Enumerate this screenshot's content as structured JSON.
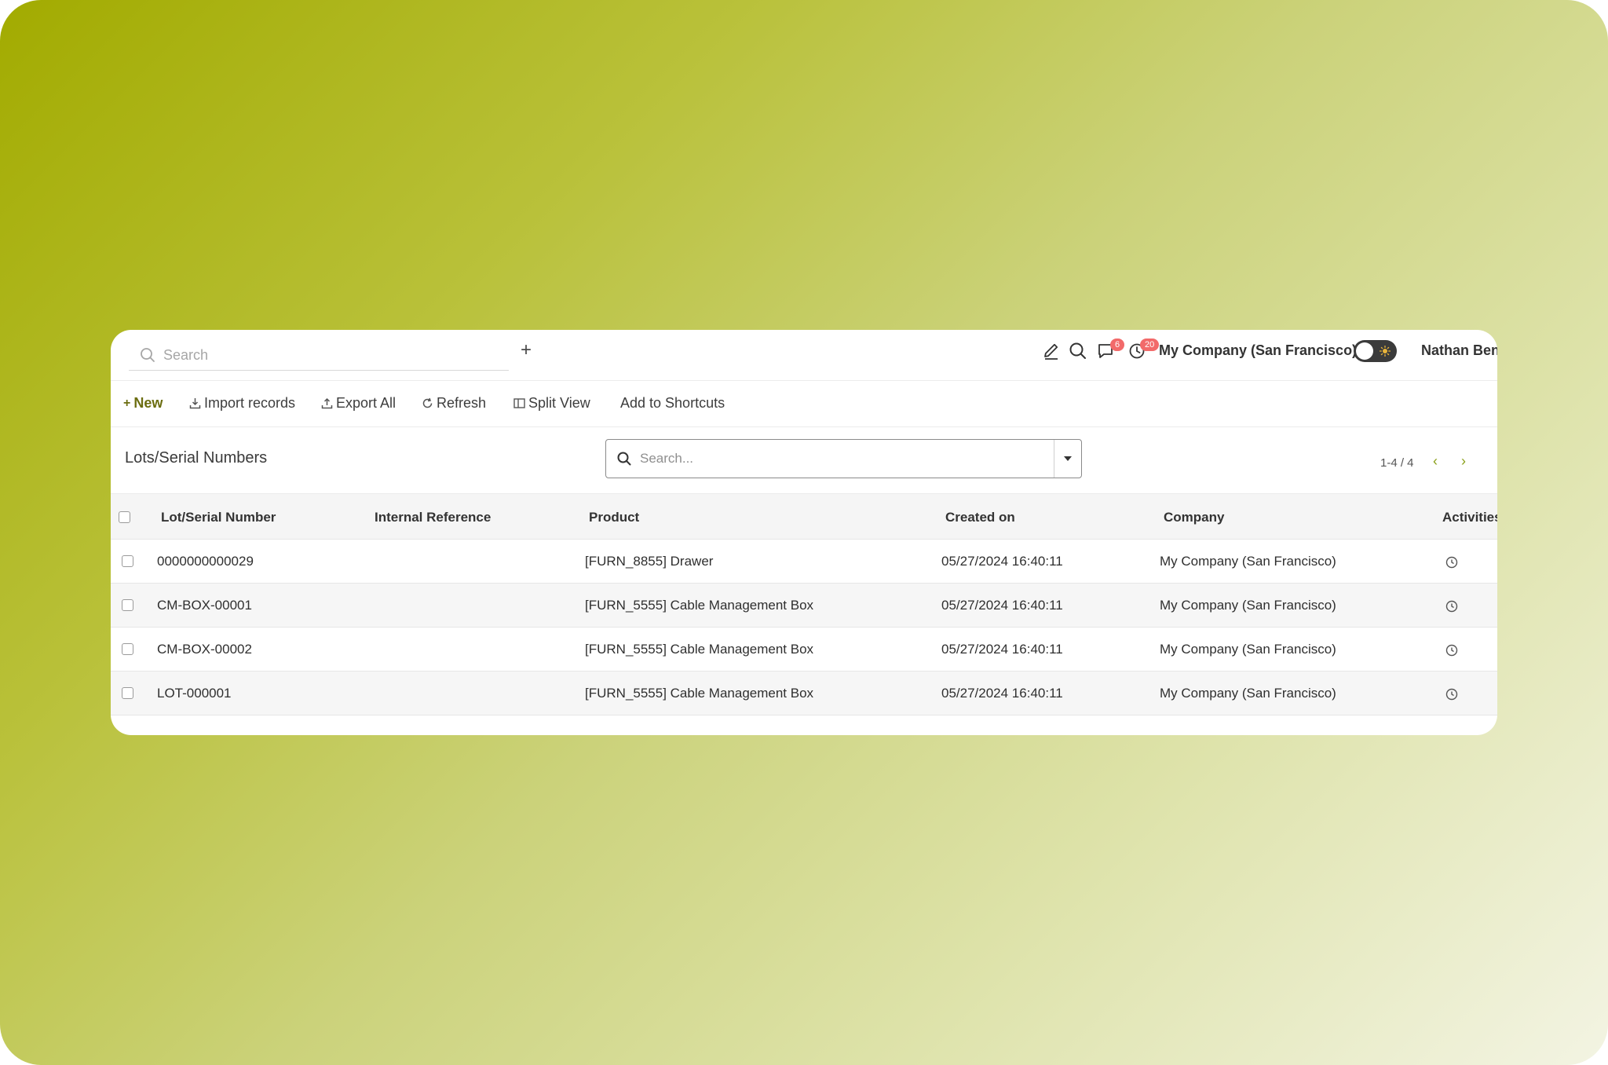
{
  "topbar": {
    "search_placeholder": "Search",
    "add_label": "+",
    "messages_badge": "6",
    "activities_badge": "20",
    "company": "My Company (San Francisco)",
    "user": "Nathan Benn"
  },
  "toolbar": {
    "new_label": "New",
    "import_label": "Import records",
    "export_label": "Export All",
    "refresh_label": "Refresh",
    "split_label": "Split View",
    "shortcuts_label": "Add to Shortcuts"
  },
  "page": {
    "title": "Lots/Serial Numbers",
    "search_placeholder": "Search...",
    "pager": "1-4 / 4"
  },
  "table": {
    "columns": [
      "Lot/Serial Number",
      "Internal Reference",
      "Product",
      "Created on",
      "Company",
      "Activities"
    ],
    "rows": [
      {
        "lot": "0000000000029",
        "ref": "",
        "product": "[FURN_8855] Drawer",
        "created": "05/27/2024 16:40:11",
        "company": "My Company (San Francisco)"
      },
      {
        "lot": "CM-BOX-00001",
        "ref": "",
        "product": "[FURN_5555] Cable Management Box",
        "created": "05/27/2024 16:40:11",
        "company": "My Company (San Francisco)"
      },
      {
        "lot": "CM-BOX-00002",
        "ref": "",
        "product": "[FURN_5555] Cable Management Box",
        "created": "05/27/2024 16:40:11",
        "company": "My Company (San Francisco)"
      },
      {
        "lot": "LOT-000001",
        "ref": "",
        "product": "[FURN_5555] Cable Management Box",
        "created": "05/27/2024 16:40:11",
        "company": "My Company (San Francisco)"
      }
    ]
  },
  "colors": {
    "accent": "#6b6d10",
    "badge": "#f26a6a",
    "backdrop_start": "#a2ab00",
    "backdrop_end": "#f3f4e3"
  }
}
